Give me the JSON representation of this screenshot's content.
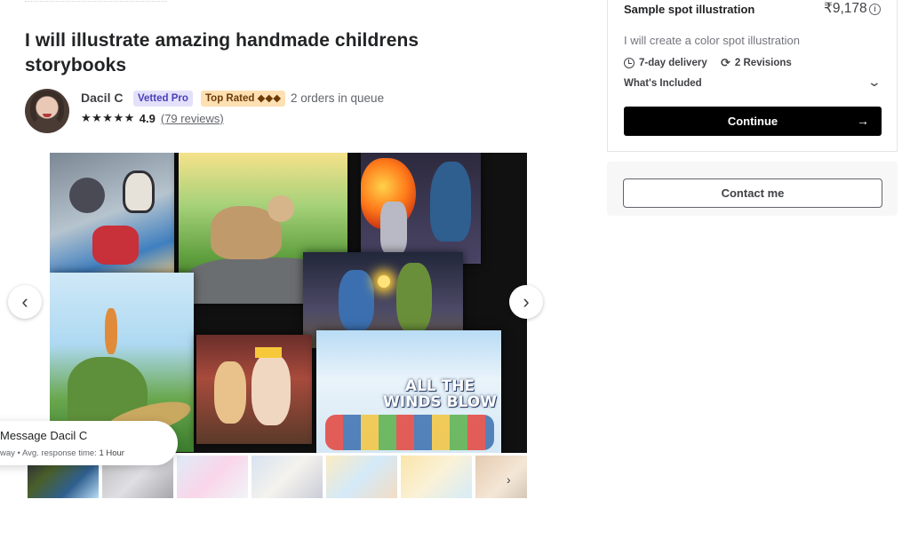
{
  "gig": {
    "title": "I will illustrate amazing handmade childrens storybooks"
  },
  "seller": {
    "name": "Dacil C",
    "badges": {
      "vetted": "Vetted Pro",
      "top_rated": "Top Rated ◆◆◆"
    },
    "orders_in_queue": "2 orders in queue",
    "stars": "★★★★★",
    "rating": "4.9",
    "reviews": "(79 reviews)"
  },
  "gallery": {
    "cover_text": "ALL THE WINDS BLOW",
    "prev_label": "‹",
    "next_label": "›",
    "thumbs_next": "›"
  },
  "message": {
    "title": "Message Dacil C",
    "away": "way",
    "separator": "•",
    "response_label": "Avg. response time:",
    "response_value": "1 Hour"
  },
  "package": {
    "name": "Sample spot illustration",
    "price": "₹9,178",
    "description": "I will create a color spot illustration",
    "delivery": "7-day delivery",
    "revisions": "2 Revisions",
    "included_label": "What's Included",
    "continue_label": "Continue",
    "continue_arrow": "→"
  },
  "contact": {
    "label": "Contact me"
  },
  "colors": {
    "vetted_bg": "#e3e1fa",
    "top_rated_bg": "#ffe0b2",
    "button_black": "#000000"
  }
}
